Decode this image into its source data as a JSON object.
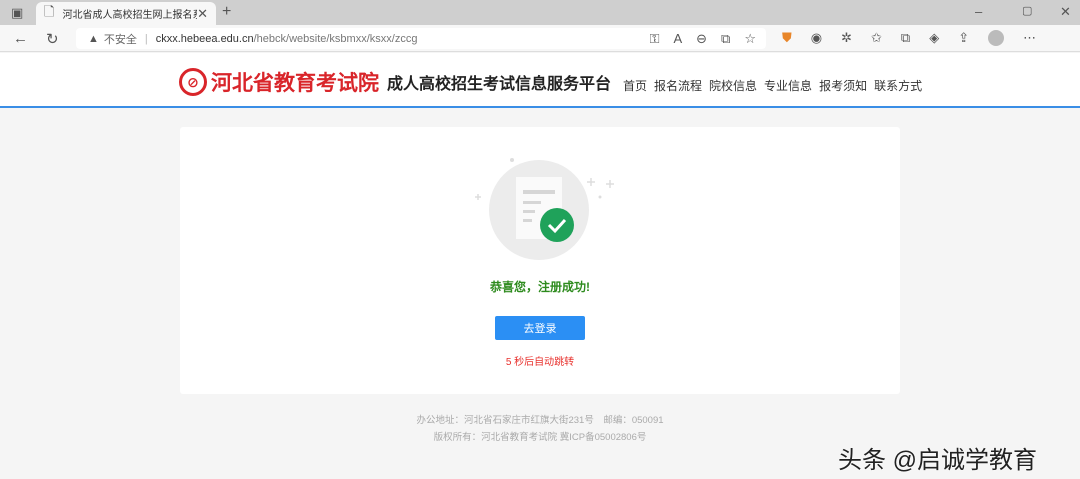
{
  "browser": {
    "tab_title": "河北省成人高校招生网上报名系统",
    "security": "不安全",
    "url_host": "ckxx.hebeea.edu.cn",
    "url_path": "/hebck/website/ksbmxx/ksxx/zccg"
  },
  "header": {
    "org_name": "河北省教育考试院",
    "platform": "成人高校招生考试信息服务平台",
    "nav": [
      "首页",
      "报名流程",
      "院校信息",
      "专业信息",
      "报考须知",
      "联系方式"
    ]
  },
  "main": {
    "message": "恭喜您，注册成功!",
    "login_button": "去登录",
    "redirect": "5 秒后自动跳转"
  },
  "footer": {
    "address": "办公地址：河北省石家庄市红旗大街231号　邮编：050091",
    "copyright": "版权所有：河北省教育考试院 冀ICP备05002806号"
  },
  "watermark": "头条 @启诚学教育",
  "colors": {
    "brand_red": "#d9252a",
    "accent_blue": "#2b8ff4",
    "success_green": "#2e8b1e"
  }
}
